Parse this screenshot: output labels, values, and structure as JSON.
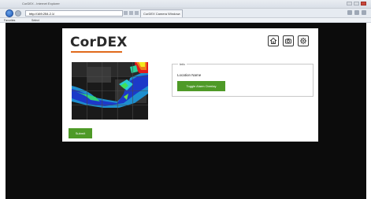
{
  "browser": {
    "title": "CorDEX - Internet Explorer",
    "address": "http://169.254.2.1/",
    "tab_label": "CorDEX Camera Window",
    "favorites_label": "Favorites",
    "suggested_sites_label": "Select"
  },
  "app": {
    "logo": "CorDEX",
    "accent_color": "#e06a1c",
    "button_color": "#4e9a27"
  },
  "header_icons": [
    "home-icon",
    "camera-icon",
    "gear-icon"
  ],
  "info": {
    "legend": "Info",
    "location_label": "Location Name",
    "toggle_button": "Toggle Alarm Overlay"
  },
  "actions": {
    "submit": "Submit"
  }
}
